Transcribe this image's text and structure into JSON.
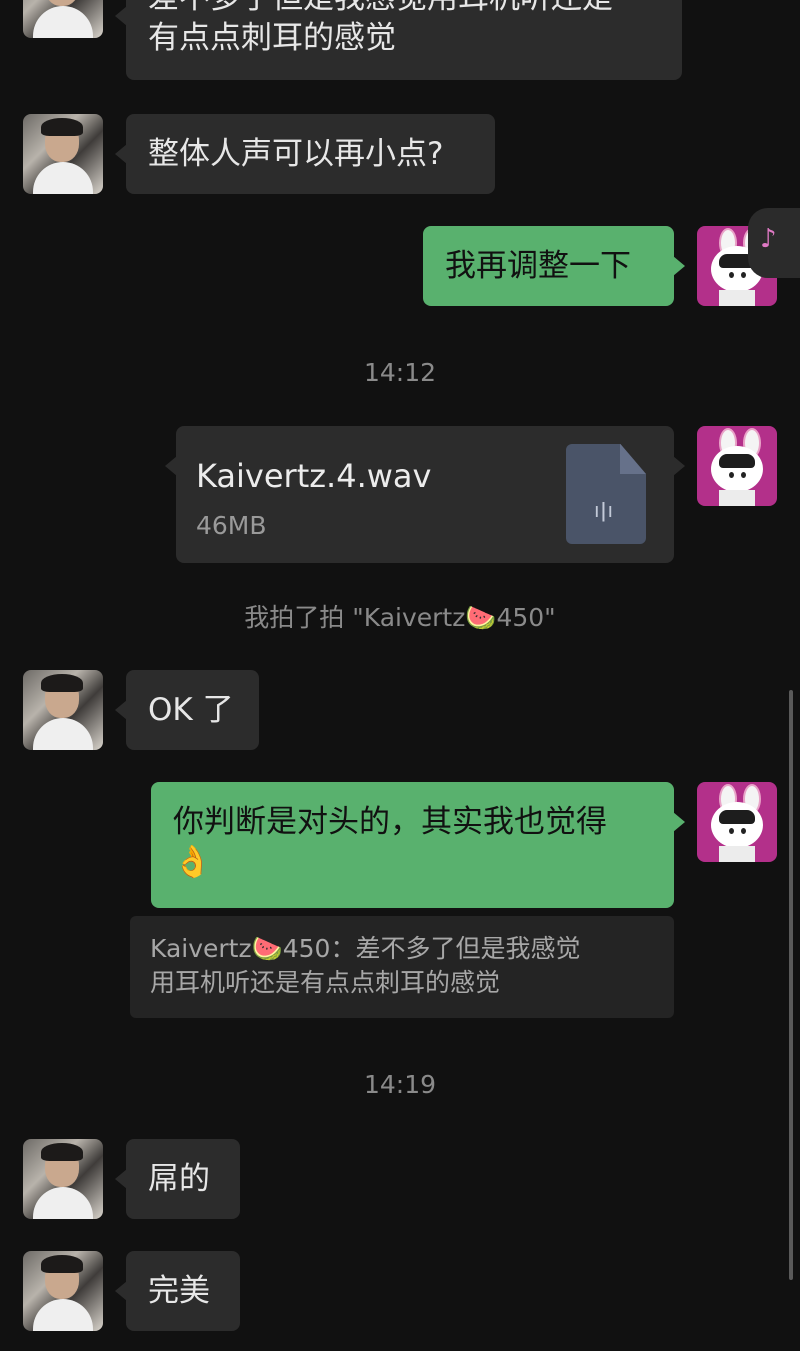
{
  "messages": {
    "m1_text": "差不多了但是我感觉用耳机听还是\n有点点刺耳的感觉",
    "m2_text": "整体人声可以再小点?",
    "m3_text": "我再调整一下",
    "time1": "14:12",
    "file": {
      "name": "Kaivertz.4.wav",
      "size": "46MB",
      "icon": "audio-file-icon"
    },
    "pat_notice": "我拍了拍 \"Kaivertz🍉450\"",
    "m5_text": "OK 了",
    "m6_text": "你判断是对头的，其实我也觉得\n👌",
    "quote_text": "Kaivertz🍉450：差不多了但是我感觉\n用耳机听还是有点点刺耳的感觉",
    "time2": "14:19",
    "m7_text": "屌的",
    "m8_text": "完美"
  },
  "colors": {
    "background": "#111111",
    "incoming_bubble": "#2c2c2c",
    "outgoing_bubble": "#59b16e"
  }
}
